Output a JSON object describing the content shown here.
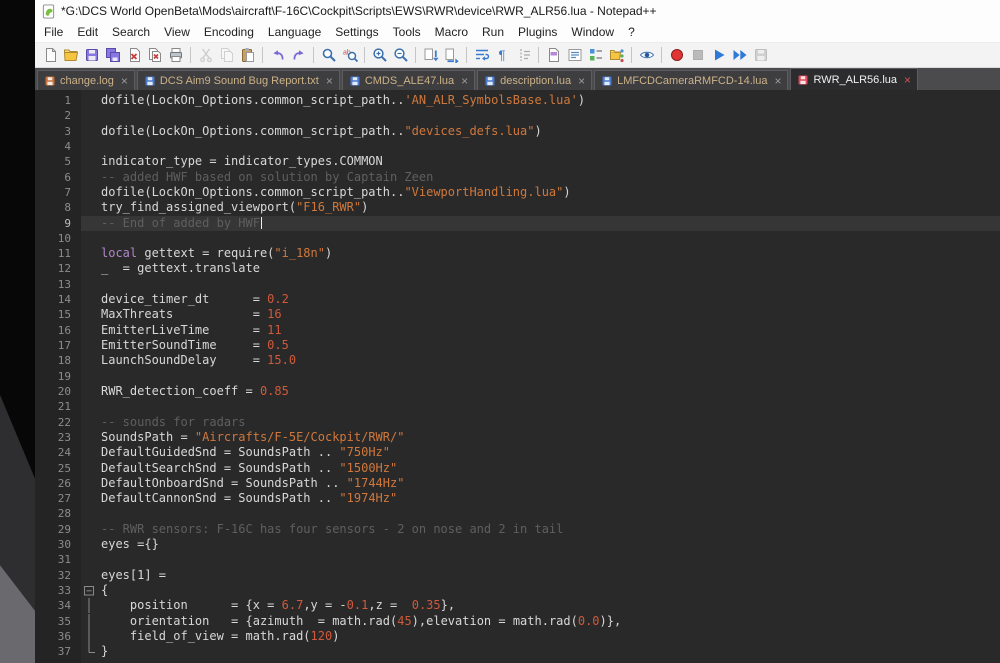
{
  "window": {
    "title": "*G:\\DCS World OpenBeta\\Mods\\aircraft\\F-16C\\Cockpit\\Scripts\\EWS\\RWR\\device\\RWR_ALR56.lua - Notepad++"
  },
  "menu": {
    "items": [
      "File",
      "Edit",
      "Search",
      "View",
      "Encoding",
      "Language",
      "Settings",
      "Tools",
      "Macro",
      "Run",
      "Plugins",
      "Window",
      "?"
    ]
  },
  "toolbar": {
    "items": [
      {
        "icon": "new-file"
      },
      {
        "icon": "open-folder"
      },
      {
        "icon": "save"
      },
      {
        "icon": "save-all"
      },
      {
        "icon": "close"
      },
      {
        "icon": "close-all"
      },
      {
        "icon": "print"
      },
      {
        "sep": true
      },
      {
        "icon": "cut",
        "disabled": true
      },
      {
        "icon": "copy",
        "disabled": true
      },
      {
        "icon": "paste"
      },
      {
        "sep": true
      },
      {
        "icon": "undo"
      },
      {
        "icon": "redo"
      },
      {
        "sep": true
      },
      {
        "icon": "find"
      },
      {
        "icon": "replace"
      },
      {
        "sep": true
      },
      {
        "icon": "zoom-in"
      },
      {
        "icon": "zoom-out"
      },
      {
        "sep": true
      },
      {
        "icon": "sync-scroll-v"
      },
      {
        "icon": "sync-scroll-h"
      },
      {
        "sep": true
      },
      {
        "icon": "word-wrap"
      },
      {
        "icon": "show-all-characters"
      },
      {
        "icon": "indent-guide"
      },
      {
        "sep": true
      },
      {
        "icon": "doc-map"
      },
      {
        "icon": "doc-list"
      },
      {
        "icon": "function-list"
      },
      {
        "icon": "folder-as-workspace"
      },
      {
        "sep": true
      },
      {
        "icon": "monitoring"
      },
      {
        "sep": true
      },
      {
        "icon": "record-macro"
      },
      {
        "icon": "stop-record",
        "disabled": true
      },
      {
        "icon": "play-macro"
      },
      {
        "icon": "run-macro-multiple"
      },
      {
        "icon": "save-macro",
        "disabled": true
      }
    ]
  },
  "tabs": [
    {
      "label": "change.log",
      "state": "modified",
      "icon_color": "#c9713a",
      "active": false
    },
    {
      "label": "DCS Aim9 Sound Bug Report.txt",
      "state": "saved",
      "icon_color": "#4a7ad0",
      "active": false
    },
    {
      "label": "CMDS_ALE47.lua",
      "state": "saved",
      "icon_color": "#4a7ad0",
      "active": false
    },
    {
      "label": "description.lua",
      "state": "saved",
      "icon_color": "#4a7ad0",
      "active": false
    },
    {
      "label": "LMFCDCameraRMFCD-14.lua",
      "state": "saved",
      "icon_color": "#4a7ad0",
      "active": false
    },
    {
      "label": "RWR_ALR56.lua",
      "state": "modified",
      "icon_color": "#e04858",
      "active": true
    }
  ],
  "editor": {
    "lines": [
      {
        "n": 1,
        "seg": [
          [
            "d",
            "dofile(LockOn_Options.common_script_path.."
          ],
          [
            "s",
            "'AN_ALR_SymbolsBase.lua'"
          ],
          [
            "d",
            ")"
          ]
        ]
      },
      {
        "n": 2,
        "seg": []
      },
      {
        "n": 3,
        "seg": [
          [
            "d",
            "dofile(LockOn_Options.common_script_path.."
          ],
          [
            "s",
            "\"devices_defs.lua\""
          ],
          [
            "d",
            ")"
          ]
        ]
      },
      {
        "n": 4,
        "seg": []
      },
      {
        "n": 5,
        "seg": [
          [
            "d",
            "indicator_type = indicator_types.COMMON"
          ]
        ]
      },
      {
        "n": 6,
        "seg": [
          [
            "c",
            "-- added HWF based on solution by Captain Zeen"
          ]
        ]
      },
      {
        "n": 7,
        "seg": [
          [
            "d",
            "dofile(LockOn_Options.common_script_path.."
          ],
          [
            "s",
            "\"ViewportHandling.lua\""
          ],
          [
            "d",
            ")"
          ]
        ]
      },
      {
        "n": 8,
        "seg": [
          [
            "d",
            "try_find_assigned_viewport("
          ],
          [
            "s",
            "\"F16_RWR\""
          ],
          [
            "d",
            ")"
          ]
        ]
      },
      {
        "n": 9,
        "seg": [
          [
            "c",
            "-- End of added by HWF"
          ]
        ],
        "current": true,
        "caret": true
      },
      {
        "n": 10,
        "seg": []
      },
      {
        "n": 11,
        "seg": [
          [
            "k",
            "local"
          ],
          [
            "d",
            " gettext = require("
          ],
          [
            "s",
            "\"i_18n\""
          ],
          [
            "d",
            ")"
          ]
        ]
      },
      {
        "n": 12,
        "seg": [
          [
            "d",
            "_  = gettext.translate"
          ]
        ]
      },
      {
        "n": 13,
        "seg": []
      },
      {
        "n": 14,
        "seg": [
          [
            "d",
            "device_timer_dt      = "
          ],
          [
            "n2",
            "0.2"
          ]
        ]
      },
      {
        "n": 15,
        "seg": [
          [
            "d",
            "MaxThreats           = "
          ],
          [
            "n2",
            "16"
          ]
        ]
      },
      {
        "n": 16,
        "seg": [
          [
            "d",
            "EmitterLiveTime      = "
          ],
          [
            "n2",
            "11"
          ]
        ]
      },
      {
        "n": 17,
        "seg": [
          [
            "d",
            "EmitterSoundTime     = "
          ],
          [
            "n2",
            "0.5"
          ]
        ]
      },
      {
        "n": 18,
        "seg": [
          [
            "d",
            "LaunchSoundDelay     = "
          ],
          [
            "n2",
            "15.0"
          ]
        ]
      },
      {
        "n": 19,
        "seg": []
      },
      {
        "n": 20,
        "seg": [
          [
            "d",
            "RWR_detection_coeff = "
          ],
          [
            "n2",
            "0.85"
          ]
        ]
      },
      {
        "n": 21,
        "seg": []
      },
      {
        "n": 22,
        "seg": [
          [
            "c",
            "-- sounds for radars"
          ]
        ]
      },
      {
        "n": 23,
        "seg": [
          [
            "d",
            "SoundsPath = "
          ],
          [
            "s",
            "\"Aircrafts/F-5E/Cockpit/RWR/\""
          ]
        ]
      },
      {
        "n": 24,
        "seg": [
          [
            "d",
            "DefaultGuidedSnd = SoundsPath .. "
          ],
          [
            "s",
            "\"750Hz\""
          ]
        ]
      },
      {
        "n": 25,
        "seg": [
          [
            "d",
            "DefaultSearchSnd = SoundsPath .. "
          ],
          [
            "s",
            "\"1500Hz\""
          ]
        ]
      },
      {
        "n": 26,
        "seg": [
          [
            "d",
            "DefaultOnboardSnd = SoundsPath .. "
          ],
          [
            "s",
            "\"1744Hz\""
          ]
        ]
      },
      {
        "n": 27,
        "seg": [
          [
            "d",
            "DefaultCannonSnd = SoundsPath .. "
          ],
          [
            "s",
            "\"1974Hz\""
          ]
        ]
      },
      {
        "n": 28,
        "seg": []
      },
      {
        "n": 29,
        "seg": [
          [
            "c",
            "-- RWR sensors: F-16C has four sensors - 2 on nose and 2 in tail"
          ]
        ]
      },
      {
        "n": 30,
        "seg": [
          [
            "d",
            "eyes ={}"
          ]
        ]
      },
      {
        "n": 31,
        "seg": []
      },
      {
        "n": 32,
        "seg": [
          [
            "d",
            "eyes[1] ="
          ]
        ]
      },
      {
        "n": 33,
        "seg": [
          [
            "d",
            "{"
          ]
        ],
        "fold": "open"
      },
      {
        "n": 34,
        "seg": [
          [
            "d",
            "    position      = {x = "
          ],
          [
            "n2",
            "6.7"
          ],
          [
            "d",
            ",y = -"
          ],
          [
            "n2",
            "0.1"
          ],
          [
            "d",
            ",z =  "
          ],
          [
            "n2",
            "0.35"
          ],
          [
            "d",
            "},"
          ]
        ],
        "fold": "mid"
      },
      {
        "n": 35,
        "seg": [
          [
            "d",
            "    orientation   = {azimuth  = math.rad("
          ],
          [
            "n2",
            "45"
          ],
          [
            "d",
            "),elevation = math.rad("
          ],
          [
            "n2",
            "0.0"
          ],
          [
            "d",
            ")},"
          ]
        ],
        "fold": "mid"
      },
      {
        "n": 36,
        "seg": [
          [
            "d",
            "    field_of_view = math.rad("
          ],
          [
            "n2",
            "120"
          ],
          [
            "d",
            ")"
          ]
        ],
        "fold": "mid"
      },
      {
        "n": 37,
        "seg": [
          [
            "d",
            "}"
          ]
        ],
        "fold": "end"
      }
    ]
  },
  "colors": {
    "editor_bg": "#292929",
    "gutter_bg": "#242424",
    "gutter_text": "#8c8c8c",
    "text_default": "#d8d8d8",
    "comment": "#5f5f5f",
    "string": "#d0783c",
    "number": "#cf5a3c",
    "keyword": "#b186c8",
    "current_line": "#363636",
    "tab_text": "#cdb287",
    "tab_text_active": "#f0f0f0"
  }
}
